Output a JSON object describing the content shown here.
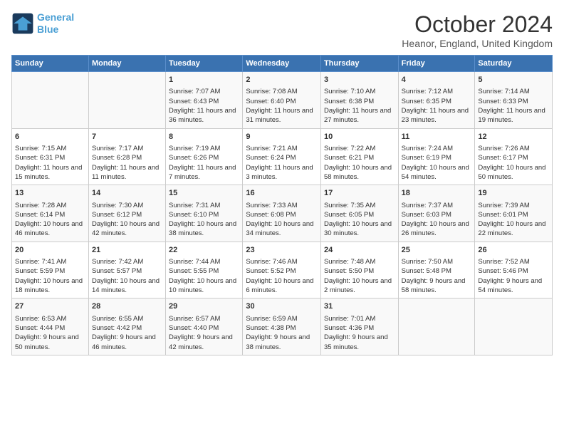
{
  "header": {
    "logo_line1": "General",
    "logo_line2": "Blue",
    "month": "October 2024",
    "location": "Heanor, England, United Kingdom"
  },
  "days_of_week": [
    "Sunday",
    "Monday",
    "Tuesday",
    "Wednesday",
    "Thursday",
    "Friday",
    "Saturday"
  ],
  "weeks": [
    [
      {
        "day": "",
        "info": ""
      },
      {
        "day": "",
        "info": ""
      },
      {
        "day": "1",
        "info": "Sunrise: 7:07 AM\nSunset: 6:43 PM\nDaylight: 11 hours and 36 minutes."
      },
      {
        "day": "2",
        "info": "Sunrise: 7:08 AM\nSunset: 6:40 PM\nDaylight: 11 hours and 31 minutes."
      },
      {
        "day": "3",
        "info": "Sunrise: 7:10 AM\nSunset: 6:38 PM\nDaylight: 11 hours and 27 minutes."
      },
      {
        "day": "4",
        "info": "Sunrise: 7:12 AM\nSunset: 6:35 PM\nDaylight: 11 hours and 23 minutes."
      },
      {
        "day": "5",
        "info": "Sunrise: 7:14 AM\nSunset: 6:33 PM\nDaylight: 11 hours and 19 minutes."
      }
    ],
    [
      {
        "day": "6",
        "info": "Sunrise: 7:15 AM\nSunset: 6:31 PM\nDaylight: 11 hours and 15 minutes."
      },
      {
        "day": "7",
        "info": "Sunrise: 7:17 AM\nSunset: 6:28 PM\nDaylight: 11 hours and 11 minutes."
      },
      {
        "day": "8",
        "info": "Sunrise: 7:19 AM\nSunset: 6:26 PM\nDaylight: 11 hours and 7 minutes."
      },
      {
        "day": "9",
        "info": "Sunrise: 7:21 AM\nSunset: 6:24 PM\nDaylight: 11 hours and 3 minutes."
      },
      {
        "day": "10",
        "info": "Sunrise: 7:22 AM\nSunset: 6:21 PM\nDaylight: 10 hours and 58 minutes."
      },
      {
        "day": "11",
        "info": "Sunrise: 7:24 AM\nSunset: 6:19 PM\nDaylight: 10 hours and 54 minutes."
      },
      {
        "day": "12",
        "info": "Sunrise: 7:26 AM\nSunset: 6:17 PM\nDaylight: 10 hours and 50 minutes."
      }
    ],
    [
      {
        "day": "13",
        "info": "Sunrise: 7:28 AM\nSunset: 6:14 PM\nDaylight: 10 hours and 46 minutes."
      },
      {
        "day": "14",
        "info": "Sunrise: 7:30 AM\nSunset: 6:12 PM\nDaylight: 10 hours and 42 minutes."
      },
      {
        "day": "15",
        "info": "Sunrise: 7:31 AM\nSunset: 6:10 PM\nDaylight: 10 hours and 38 minutes."
      },
      {
        "day": "16",
        "info": "Sunrise: 7:33 AM\nSunset: 6:08 PM\nDaylight: 10 hours and 34 minutes."
      },
      {
        "day": "17",
        "info": "Sunrise: 7:35 AM\nSunset: 6:05 PM\nDaylight: 10 hours and 30 minutes."
      },
      {
        "day": "18",
        "info": "Sunrise: 7:37 AM\nSunset: 6:03 PM\nDaylight: 10 hours and 26 minutes."
      },
      {
        "day": "19",
        "info": "Sunrise: 7:39 AM\nSunset: 6:01 PM\nDaylight: 10 hours and 22 minutes."
      }
    ],
    [
      {
        "day": "20",
        "info": "Sunrise: 7:41 AM\nSunset: 5:59 PM\nDaylight: 10 hours and 18 minutes."
      },
      {
        "day": "21",
        "info": "Sunrise: 7:42 AM\nSunset: 5:57 PM\nDaylight: 10 hours and 14 minutes."
      },
      {
        "day": "22",
        "info": "Sunrise: 7:44 AM\nSunset: 5:55 PM\nDaylight: 10 hours and 10 minutes."
      },
      {
        "day": "23",
        "info": "Sunrise: 7:46 AM\nSunset: 5:52 PM\nDaylight: 10 hours and 6 minutes."
      },
      {
        "day": "24",
        "info": "Sunrise: 7:48 AM\nSunset: 5:50 PM\nDaylight: 10 hours and 2 minutes."
      },
      {
        "day": "25",
        "info": "Sunrise: 7:50 AM\nSunset: 5:48 PM\nDaylight: 9 hours and 58 minutes."
      },
      {
        "day": "26",
        "info": "Sunrise: 7:52 AM\nSunset: 5:46 PM\nDaylight: 9 hours and 54 minutes."
      }
    ],
    [
      {
        "day": "27",
        "info": "Sunrise: 6:53 AM\nSunset: 4:44 PM\nDaylight: 9 hours and 50 minutes."
      },
      {
        "day": "28",
        "info": "Sunrise: 6:55 AM\nSunset: 4:42 PM\nDaylight: 9 hours and 46 minutes."
      },
      {
        "day": "29",
        "info": "Sunrise: 6:57 AM\nSunset: 4:40 PM\nDaylight: 9 hours and 42 minutes."
      },
      {
        "day": "30",
        "info": "Sunrise: 6:59 AM\nSunset: 4:38 PM\nDaylight: 9 hours and 38 minutes."
      },
      {
        "day": "31",
        "info": "Sunrise: 7:01 AM\nSunset: 4:36 PM\nDaylight: 9 hours and 35 minutes."
      },
      {
        "day": "",
        "info": ""
      },
      {
        "day": "",
        "info": ""
      }
    ]
  ]
}
